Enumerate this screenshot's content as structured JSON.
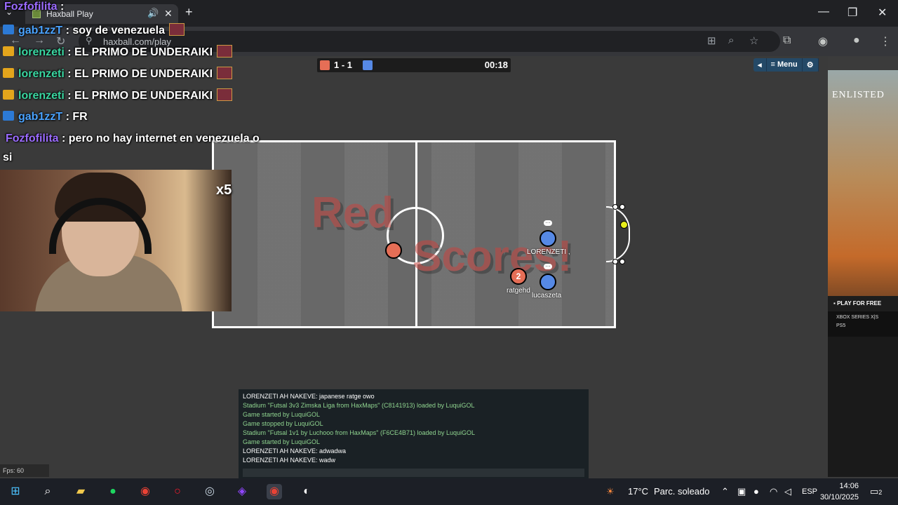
{
  "browser": {
    "tab_title": "Haxball Play",
    "url": "haxball.com/play",
    "new_tab": "+",
    "audio_icon": "🔊",
    "close_tab": "✕",
    "minimize": "—",
    "maximize": "❐",
    "close": "✕"
  },
  "game": {
    "score": "1 - 1",
    "time": "00:18",
    "red_color": "#e56e56",
    "blue_color": "#5689e5",
    "menu_buttons": [
      "◂",
      "≡ Menu",
      "⚙"
    ],
    "big_message_line1": "Red",
    "big_message_line2": "Scores!",
    "players": {
      "red_center_label": "",
      "red_attacker_number": "2",
      "red_attacker_name": "ratgehd",
      "blue_player1_name": "LORENZETI ,",
      "blue_player2_name": "lucaszeta"
    },
    "fps": "Fps: 60"
  },
  "overlay_chat": [
    {
      "user": "Fozfofilita",
      "text": " :",
      "badge": "none",
      "color": "purple"
    },
    {
      "user": "gab1zzT",
      "text": " : soy de venezuela",
      "badge": "blue",
      "color": "blue"
    },
    {
      "user": "lorenzeti",
      "text": " : EL PRIMO DE UNDERAIKI",
      "badge": "gold",
      "color": "green"
    },
    {
      "user": "lorenzeti",
      "text": " : EL PRIMO DE UNDERAIKI",
      "badge": "gold",
      "color": "green"
    },
    {
      "user": "lorenzeti",
      "text": " : EL PRIMO DE UNDERAIKI",
      "badge": "gold",
      "color": "green"
    },
    {
      "user": "gab1zzT",
      "text": " : FR",
      "badge": "blue",
      "color": "blue"
    },
    {
      "user": "Fozfofilita",
      "text": " : pero no hay internet en venezuela o",
      "badge": "none",
      "color": "purple"
    },
    {
      "user": "",
      "text": "si",
      "badge": "none",
      "color": "white"
    }
  ],
  "overlay_multiplier": "x5",
  "game_chat": [
    {
      "text": "LORENZETI AH NAKEVE: japanese ratge owo",
      "type": "white"
    },
    {
      "text": "Stadium \"Futsal 3v3 Zimska Liga from HaxMaps\" (C8141913) loaded by LuquiGOL",
      "type": "green"
    },
    {
      "text": "Game started by LuquiGOL",
      "type": "green"
    },
    {
      "text": "Game stopped by LuquiGOL",
      "type": "green"
    },
    {
      "text": "Stadium \"Futsal 1v1 by Luchooo from HaxMaps\" (F6CE4B71) loaded by LuquiGOL",
      "type": "green"
    },
    {
      "text": "Game started by LuquiGOL",
      "type": "green"
    },
    {
      "text": "LORENZETI AH NAKEVE: adwadwa",
      "type": "white"
    },
    {
      "text": "LORENZETI AH NAKEVE: wadw",
      "type": "white"
    }
  ],
  "ad": {
    "logo": "ENLISTED",
    "play_button": "PLAY FOR FREE",
    "platform1": "XBOX SERIES X|S",
    "platform2": "PS5"
  },
  "taskbar": {
    "weather_temp": "17°C",
    "weather_text": "Parc. soleado",
    "language": "ESP",
    "time": "14:06",
    "date": "30/10/2025",
    "notifications": "2"
  }
}
